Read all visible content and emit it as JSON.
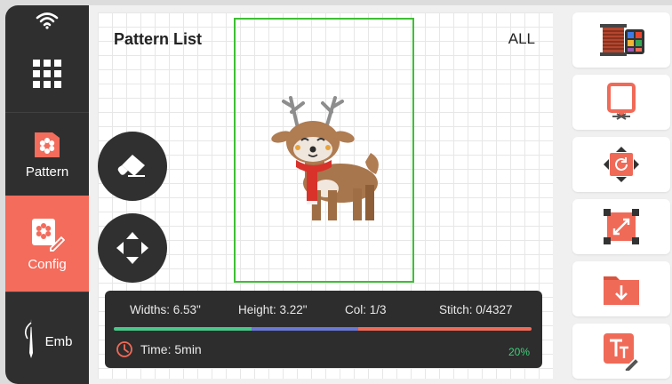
{
  "sidebar": {
    "items": [
      {
        "label": "",
        "icon": "apps-grid-icon"
      },
      {
        "label": "Pattern",
        "icon": "flower-card-icon"
      },
      {
        "label": "Config",
        "icon": "flower-edit-icon"
      },
      {
        "label": "Emb",
        "icon": "needle-thread-icon"
      }
    ]
  },
  "canvas": {
    "title": "Pattern List",
    "filter": "ALL"
  },
  "info": {
    "widths": "Widths: 6.53\"",
    "height": "Height: 3.22\"",
    "col": "Col: 1/3",
    "stitch": "Stitch: 0/4327",
    "time": "Time: 5min",
    "percent": "20%",
    "progress_colors": [
      "#48c98a",
      "#6a78d6",
      "#f06a58"
    ]
  },
  "toolbar": {
    "icons": [
      "thread-color-icon",
      "hoop-icon",
      "rotate-icon",
      "resize-icon",
      "folder-download-icon",
      "text-edit-icon"
    ]
  },
  "colors": {
    "accent": "#f36c5c",
    "dark": "#2f2f2f",
    "frame": "#3fbf35"
  }
}
